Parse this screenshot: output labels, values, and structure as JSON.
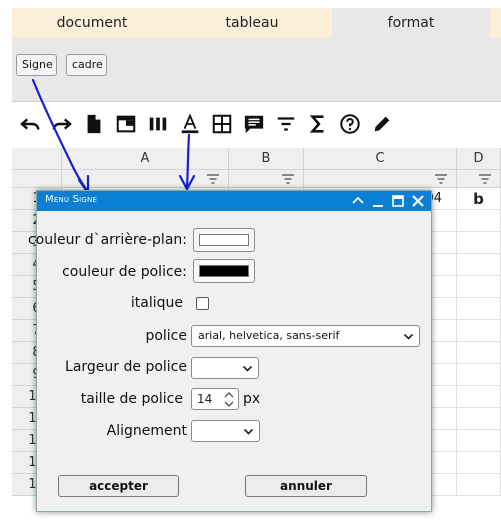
{
  "tabs": [
    {
      "label": "document"
    },
    {
      "label": "tableau"
    },
    {
      "label": "format"
    }
  ],
  "subtoolbar": {
    "signe_label": "Signe",
    "cadre_label": "cadre"
  },
  "toolbar_icons": [
    "undo-icon",
    "redo-icon",
    "document-icon",
    "window-icon",
    "columns-icon",
    "text-color-icon",
    "table-grid-icon",
    "comment-icon",
    "filter-icon",
    "sum-icon",
    "help-icon",
    "pencil-icon"
  ],
  "grid": {
    "columns": [
      "A",
      "B",
      "C",
      "D"
    ],
    "rows": [
      "1",
      "2",
      "3",
      "4",
      "5",
      "6",
      "7",
      "8",
      "9",
      "10",
      "11",
      "12",
      "13",
      "14"
    ],
    "cells": {
      "C1": "04",
      "D1": "b"
    }
  },
  "dialog": {
    "title": "Menu Signe",
    "bg_color_label": "couleur d`arrière-plan:",
    "font_color_label": "couleur de police:",
    "italic_label": "italique",
    "font_label": "police",
    "font_value": "arial, helvetica, sans-serif",
    "font_width_label": "Largeur de police",
    "font_width_value": "",
    "font_size_label": "taille de police",
    "font_size_value": "14",
    "font_size_unit": "px",
    "alignment_label": "Alignement",
    "alignment_value": "",
    "accept_label": "accepter",
    "cancel_label": "annuler",
    "bg_color": "#ffffff",
    "font_color": "#000000",
    "italic_checked": false
  },
  "colors": {
    "tab_inactive": "#fbefd9",
    "tab_active": "#e8e8e8",
    "dialog_title": "#0b7fd4",
    "annotation": "#1320d6"
  }
}
